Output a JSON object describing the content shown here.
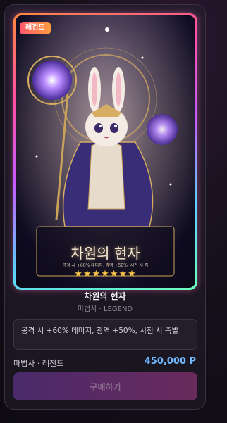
{
  "product": {
    "badge": "레전드",
    "name": "차원의 현자",
    "subtitle": "마법사 · LEGEND",
    "description": "공격 시 +60% 데미지, 광역 +50%, 시전 시 즉발",
    "category": "마법사 · 레전드",
    "price": "450,000 P",
    "buy_label": "구매하기"
  },
  "artwork": {
    "title": "차원의 현자",
    "caption": "공격 시 +60% 데미지, 광역 +50%, 시전 시 즉",
    "stars": "★★★★★★★"
  },
  "colors": {
    "badge": "#ff7a4f",
    "price": "#6fb8ff",
    "frame_gradient": [
      "#ff8a3d",
      "#ff4fa3",
      "#c45bff",
      "#5bd0ff",
      "#6dffb8"
    ],
    "button": "#5a2a66"
  }
}
